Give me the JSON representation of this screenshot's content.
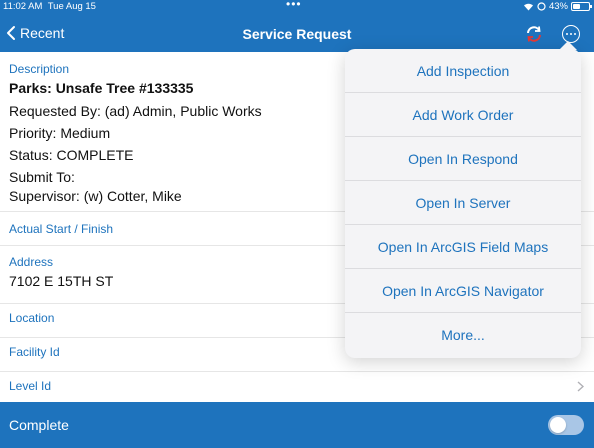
{
  "status_bar": {
    "time": "11:02 AM",
    "date": "Tue Aug 15",
    "dots": "•••",
    "battery": "43%"
  },
  "nav": {
    "back_label": "Recent",
    "title": "Service Request"
  },
  "description": {
    "label": "Description",
    "title": "Parks: Unsafe Tree #133335",
    "requested_by": "Requested By: (ad) Admin, Public Works",
    "priority": "Priority: Medium",
    "status": "Status: COMPLETE",
    "submit_to": "Submit To:",
    "supervisor": "Supervisor: (w) Cotter, Mike"
  },
  "fields": {
    "actual_start_finish": "Actual Start / Finish",
    "address_label": "Address",
    "address_value": "7102 E 15TH ST",
    "location": "Location",
    "facility_id": "Facility Id",
    "level_id": "Level Id"
  },
  "footer": {
    "label": "Complete",
    "toggle_on": false
  },
  "menu": {
    "items": [
      "Add Inspection",
      "Add Work Order",
      "Open In Respond",
      "Open In Server",
      "Open In ArcGIS Field Maps",
      "Open In ArcGIS Navigator",
      "More..."
    ]
  },
  "colors": {
    "accent": "#1e73bd",
    "menu_bg": "#f4f4f6"
  }
}
